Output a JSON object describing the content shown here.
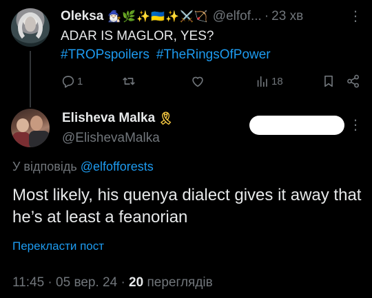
{
  "parent_tweet": {
    "author_name": "Oleksa",
    "author_emojis": "🧙🏻‍♂️🌿✨🇺🇦✨⚔️🏹",
    "handle": "@elfof...",
    "separator": "·",
    "time": "23 хв",
    "text": "ADAR IS MAGLOR, YES?",
    "hashtags": [
      "#TROPspoilers",
      "#TheRingsOfPower"
    ],
    "replies_count": "1",
    "views_count": "18",
    "more_icon": "⋮"
  },
  "main_tweet": {
    "author_name": "Elisheva Malka",
    "author_badge": "🎗",
    "handle": "@ElishevaMalka",
    "reply_prefix": "У відповідь",
    "reply_mention": "@elfofforests",
    "text": "Most likely, his quenya dialect gives it away that he’s at least a feanorian",
    "translate_label": "Перекласти пост",
    "time": "11:45",
    "separator": "·",
    "date": "05 вер. 24",
    "views_number": "20",
    "views_label": "переглядів",
    "more_icon": "⋮"
  }
}
